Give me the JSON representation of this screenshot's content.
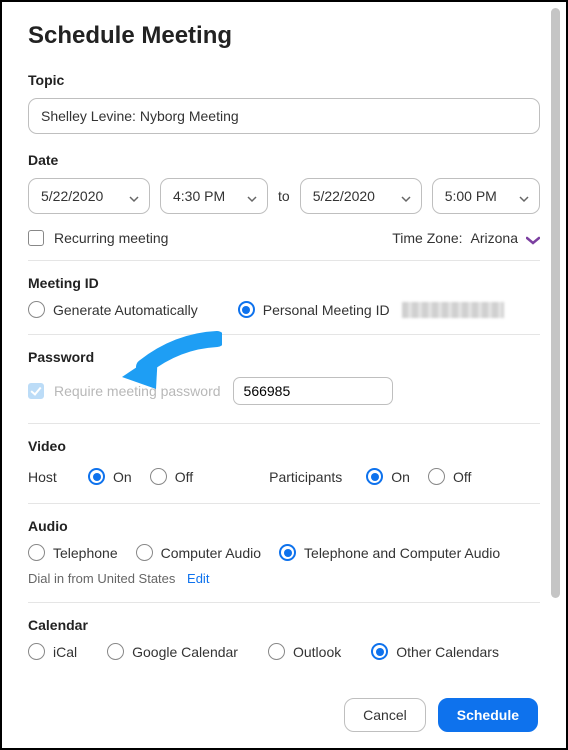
{
  "title": "Schedule Meeting",
  "topic": {
    "label": "Topic",
    "value": "Shelley Levine: Nyborg Meeting"
  },
  "date": {
    "label": "Date",
    "start_date": "5/22/2020",
    "start_time": "4:30 PM",
    "to": "to",
    "end_date": "5/22/2020",
    "end_time": "5:00 PM",
    "recurring_label": "Recurring meeting",
    "timezone_label": "Time Zone:",
    "timezone_value": "Arizona"
  },
  "meeting_id": {
    "label": "Meeting ID",
    "generate_label": "Generate Automatically",
    "personal_label": "Personal Meeting ID"
  },
  "password": {
    "label": "Password",
    "require_label": "Require meeting password",
    "value": "566985"
  },
  "video": {
    "label": "Video",
    "host_label": "Host",
    "participants_label": "Participants",
    "on_label": "On",
    "off_label": "Off"
  },
  "audio": {
    "label": "Audio",
    "telephone_label": "Telephone",
    "computer_label": "Computer Audio",
    "both_label": "Telephone and Computer Audio",
    "dial_label": "Dial in from United States",
    "edit_label": "Edit"
  },
  "calendar": {
    "label": "Calendar",
    "ical": "iCal",
    "google": "Google Calendar",
    "outlook": "Outlook",
    "other": "Other Calendars"
  },
  "buttons": {
    "cancel": "Cancel",
    "schedule": "Schedule"
  }
}
